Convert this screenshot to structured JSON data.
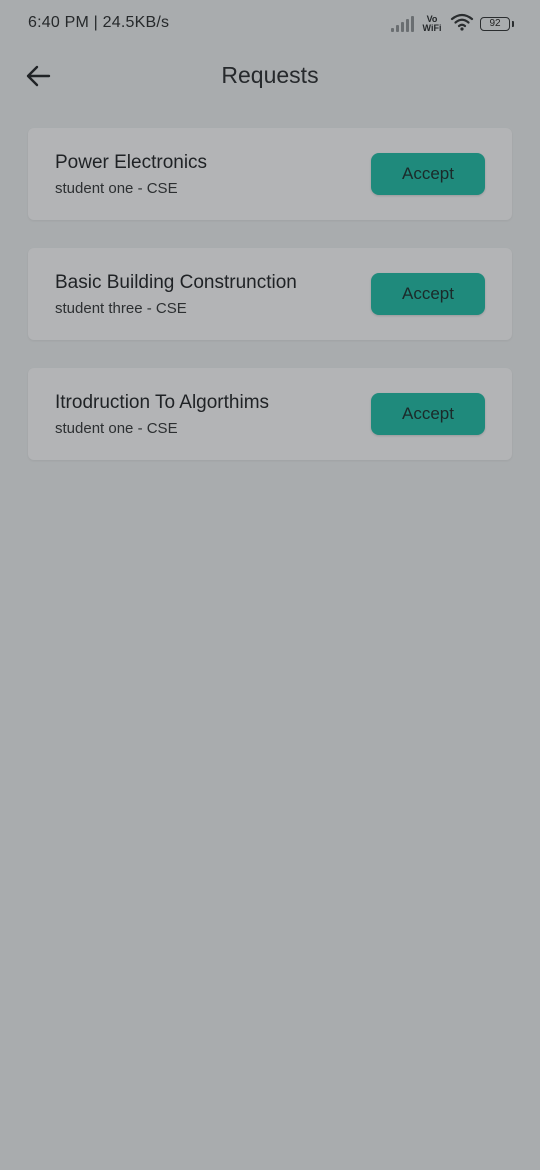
{
  "status_bar": {
    "time_text": "6:40 PM | 24.5KB/s",
    "vowifi_top": "Vo",
    "vowifi_bottom": "WiFi",
    "battery_level": "92"
  },
  "app_bar": {
    "title": "Requests",
    "back_icon": "arrow-left-icon"
  },
  "requests": [
    {
      "title": "Power Electronics",
      "subtitle": "student one - CSE",
      "action_label": "Accept"
    },
    {
      "title": "Basic Building Construnction",
      "subtitle": "student three - CSE",
      "action_label": "Accept"
    },
    {
      "title": "Itrodruction To Algorthims",
      "subtitle": "student one - CSE",
      "action_label": "Accept"
    }
  ],
  "colors": {
    "background": "#a9acae",
    "card": "#b3b4b6",
    "accent": "#1f8a7c"
  }
}
